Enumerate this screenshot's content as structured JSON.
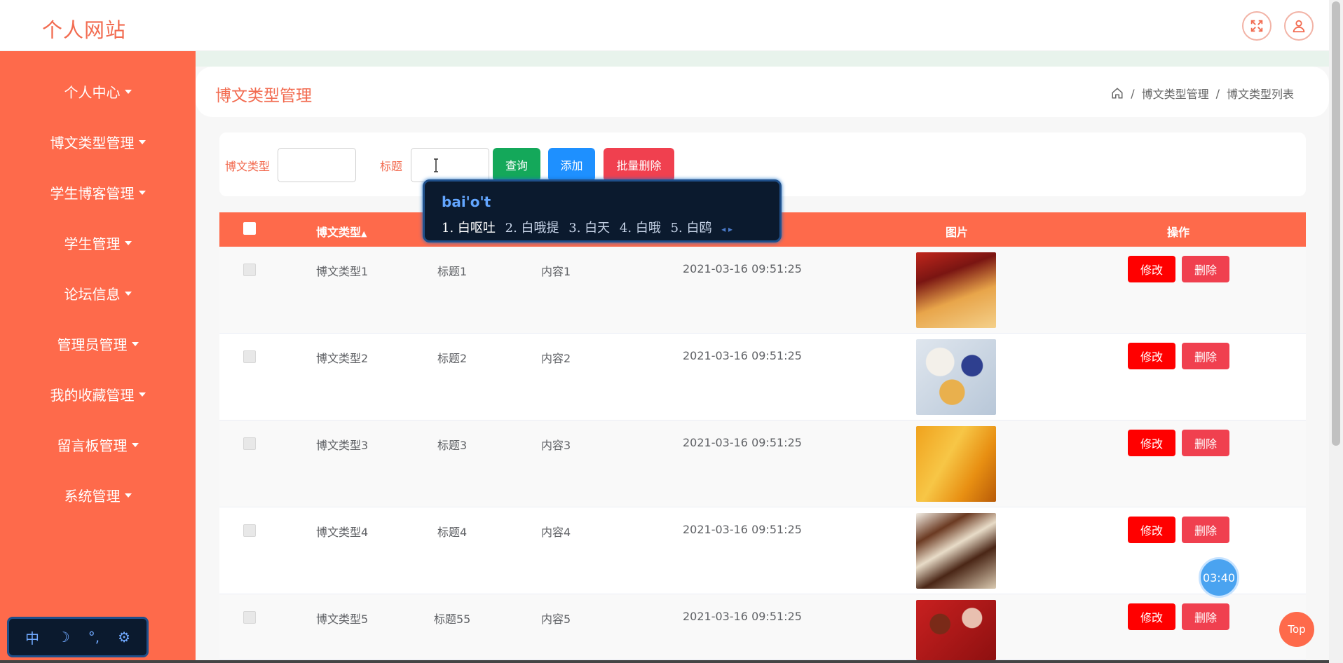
{
  "header": {
    "brand": "个人网站",
    "fullscreen_icon": "fullscreen-icon",
    "user_icon": "user-icon"
  },
  "sidebar": {
    "items": [
      {
        "label": "个人中心"
      },
      {
        "label": "博文类型管理"
      },
      {
        "label": "学生博客管理"
      },
      {
        "label": "学生管理"
      },
      {
        "label": "论坛信息"
      },
      {
        "label": "管理员管理"
      },
      {
        "label": "我的收藏管理"
      },
      {
        "label": "留言板管理"
      },
      {
        "label": "系统管理"
      }
    ]
  },
  "page": {
    "title": "博文类型管理",
    "breadcrumb": [
      "博文类型管理",
      "博文类型列表"
    ],
    "breadcrumb_sep": "/"
  },
  "search": {
    "type_label": "博文类型",
    "type_value": "",
    "title_label": "标题",
    "title_value": "",
    "query_btn": "查询",
    "add_btn": "添加",
    "batch_delete_btn": "批量删除"
  },
  "table": {
    "headers": [
      "博文类型",
      "图片",
      "操作"
    ],
    "sort_icon": "sort-icon",
    "edit_label": "修改",
    "delete_label": "删除",
    "rows": [
      {
        "type": "博文类型1",
        "title": "标题1",
        "content": "内容1",
        "time": "2021-03-16 09:51:25",
        "image": "snack-bags"
      },
      {
        "type": "博文类型2",
        "title": "标题2",
        "content": "内容2",
        "time": "2021-03-16 09:51:25",
        "image": "yogurt-bowls"
      },
      {
        "type": "博文类型3",
        "title": "标题3",
        "content": "内容3",
        "time": "2021-03-16 09:51:25",
        "image": "chips-can"
      },
      {
        "type": "博文类型4",
        "title": "标题4",
        "content": "内容4",
        "time": "2021-03-16 09:51:25",
        "image": "chocolate-bars"
      },
      {
        "type": "博文类型5",
        "title": "标题55",
        "content": "内容5",
        "time": "2021-03-16 09:51:25",
        "image": "chocolates"
      }
    ]
  },
  "ime": {
    "composition": "bai'o't",
    "candidates": [
      "1. 白呕吐",
      "2. 白哦提",
      "3. 白天",
      "4. 白哦",
      "5. 白鸥"
    ],
    "toolbar": [
      "中",
      "☽",
      "°,",
      "⚙"
    ]
  },
  "timer": "03:40",
  "top_button": "Top",
  "colors": {
    "accent": "#fe6a4b",
    "title": "#f26b50",
    "query": "#14a85a",
    "add": "#1e90ff",
    "batch_delete": "#f0404f",
    "edit": "#ff0000",
    "delete": "#f0404f"
  }
}
